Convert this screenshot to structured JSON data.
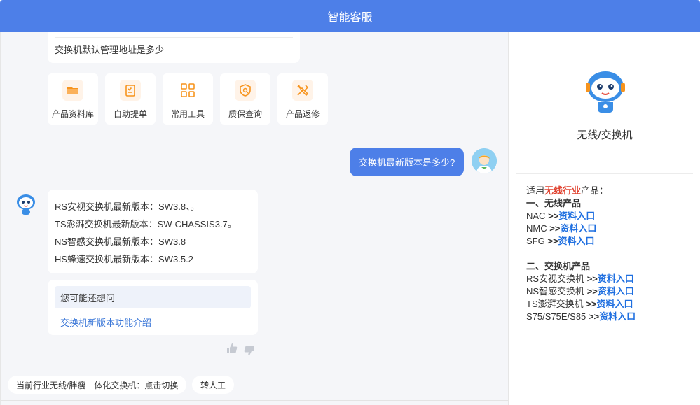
{
  "header": {
    "title": "智能客服"
  },
  "chat": {
    "previous_question": "交换机默认管理地址是多少",
    "quick_actions": [
      {
        "label": "产品资料库",
        "icon": "folder-icon"
      },
      {
        "label": "自助提单",
        "icon": "clipboard-icon"
      },
      {
        "label": "常用工具",
        "icon": "grid-apps-icon"
      },
      {
        "label": "质保查询",
        "icon": "shield-search-icon"
      },
      {
        "label": "产品返修",
        "icon": "wrench-tools-icon"
      }
    ],
    "user_message": "交换机最新版本是多少?",
    "answer_lines": [
      "RS安视交换机最新版本：SW3.8、。",
      "TS澎湃交换机最新版本：SW-CHASSIS3.7。",
      "NS智感交换机最新版本：SW3.8",
      "HS蜂速交换机最新版本：SW3.5.2"
    ],
    "suggest_title": "您可能还想问",
    "suggest_link": "交换机新版本功能介绍",
    "bottom_chip_industry": "当前行业无线/胖瘦一体化交换机：点击切换",
    "bottom_chip_agent": "转人工"
  },
  "side": {
    "category_title": "无线/交换机",
    "intro_prefix": "适用",
    "intro_highlight": "无线行业",
    "intro_suffix": "产品：",
    "section1_title": "一、无线产品",
    "section1_items": [
      "NAC",
      "NMC",
      "SFG"
    ],
    "section2_title": "二、交换机产品",
    "section2_items": [
      "RS安视交换机",
      "NS智感交换机",
      "TS澎湃交换机",
      "S75/S75E/S85"
    ],
    "arrow": ">>",
    "link_label": "资料入口"
  },
  "colors": {
    "brand_blue": "#4d7fe8",
    "accent_orange": "#f7941d",
    "highlight_red": "#e0402d",
    "link_blue": "#1f6fe0"
  }
}
